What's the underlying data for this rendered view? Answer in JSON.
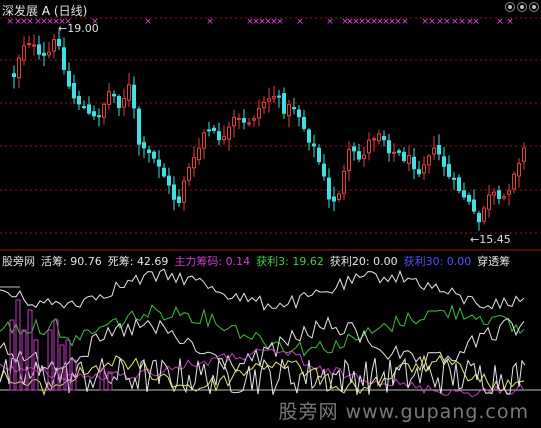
{
  "title": {
    "name": "深发展",
    "lock_glyph": "A",
    "period": "(日线)"
  },
  "annotations": {
    "high_label": "19.00",
    "low_label": "15.45",
    "arrow_high": "←",
    "arrow_low": "←"
  },
  "legend": {
    "source": "股旁网",
    "items": [
      {
        "label": "活筹:",
        "value": "90.76",
        "color": "#e8e8e8"
      },
      {
        "label": "死筹:",
        "value": "42.69",
        "color": "#e8e8e8"
      },
      {
        "label": "主力筹码:",
        "value": "0.14",
        "color": "#d040d0"
      },
      {
        "label": "获利3:",
        "value": "19.62",
        "color": "#40d040"
      },
      {
        "label": "获利20:",
        "value": "0.00",
        "color": "#e8e8e8"
      },
      {
        "label": "获利30:",
        "value": "0.00",
        "color": "#5050ff"
      },
      {
        "label": "穿透筹",
        "value": "",
        "color": "#e8e8e8"
      }
    ]
  },
  "watermark": "股旁网 www.gupang.com",
  "colors": {
    "up": "#e04040",
    "down": "#40e0e0",
    "grid": "#a01010",
    "marker": "#e050e0",
    "white_line": "#e8e8e8",
    "green_line": "#40c040",
    "magenta_line": "#c040c0",
    "yellow_line": "#e8e870"
  }
}
